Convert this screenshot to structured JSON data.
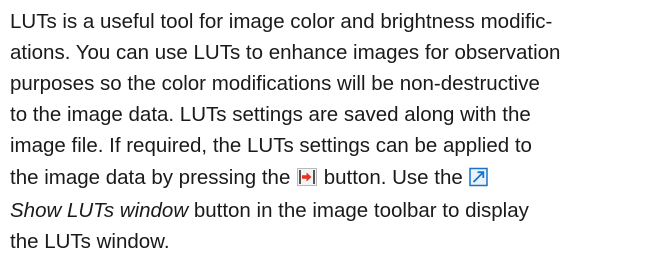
{
  "paragraph": {
    "l1": "LUTs is a useful tool for image color and brightness modific-",
    "l2": "ations. You can use LUTs to enhance images for observation",
    "l3": "purposes so the color modifications will be non-destructive",
    "l4": "to the image data. LUTs settings are saved along with the",
    "l5": "image file. If required, the LUTs settings can be applied to",
    "l6a": "the image data by pressing the ",
    "l6b": " button. Use the ",
    "l7a": "Show LUTs window",
    "l7b": " button in the image toolbar to display",
    "l8": "the LUTs window."
  },
  "icons": {
    "apply_luts": "apply-luts-icon",
    "show_luts_window": "show-luts-window-icon"
  },
  "colors": {
    "text": "#1a1a1a",
    "apply_icon_arrow": "#e8321e",
    "show_luts_icon_border": "#1a73c9",
    "show_luts_icon_fill": "#eaf3fb"
  }
}
